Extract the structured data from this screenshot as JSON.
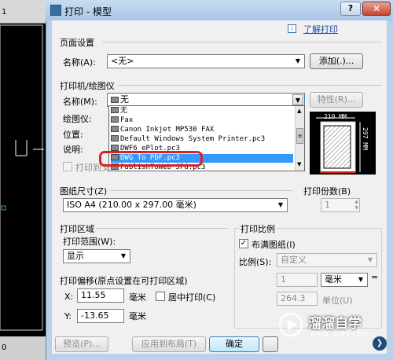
{
  "window": {
    "title": "打印 - 模型",
    "help_label": "?",
    "close_label": "✕"
  },
  "help_link": "了解打印",
  "page_setup": {
    "group_label": "页面设置",
    "name_label": "名称(A):",
    "name_value": "<无>",
    "add_button": "添加(.)..."
  },
  "printer": {
    "group_label": "打印机/绘图仪",
    "name_label": "名称(M):",
    "name_value": "无",
    "properties_button": "特性(R)...",
    "plotter_label": "绘图仪:",
    "location_label": "位置:",
    "description_label": "说明:",
    "print_to_file_label": "打印到文",
    "dropdown_items": [
      "无",
      "Fax",
      "Canon Inkjet MP530 FAX",
      "Default Windows System Printer.pc3",
      "DWF6 ePlot.pc3",
      "DWG To PDF.pc3",
      "PublishToWeb JPG.pc3"
    ],
    "selected_item": "DWG To PDF.pc3"
  },
  "preview": {
    "width_label": "210 MM",
    "height_label": "297 MM"
  },
  "paper_size": {
    "label": "图纸尺寸(Z)",
    "value": "ISO A4 (210.00 x 297.00 毫米)"
  },
  "copies": {
    "label": "打印份数(B)",
    "value": "1"
  },
  "plot_area": {
    "group_label": "打印区域",
    "range_label": "打印范围(W):",
    "range_value": "显示"
  },
  "plot_scale": {
    "group_label": "打印比例",
    "fit_label": "布满图纸(I)",
    "fit_checked": true,
    "scale_label": "比例(S):",
    "scale_value": "自定义",
    "value1": "1",
    "unit_value": "毫米",
    "equals": "=",
    "value2": "264.3",
    "unit_label": "单位(U)"
  },
  "plot_offset": {
    "group_label": "打印偏移(原点设置在可打印区域)",
    "x_label": "X:",
    "x_value": "11.55",
    "x_unit": "毫米",
    "center_label": "居中打印(C)",
    "y_label": "Y:",
    "y_value": "-13.65",
    "y_unit": "毫米"
  },
  "buttons": {
    "preview": "预览(P)...",
    "apply": "应用到布局(T)",
    "ok": "确定"
  },
  "cad": {
    "tab_text": "1",
    "status_text": "0"
  },
  "watermark": {
    "brand": "溜溜自学",
    "url": "ZIXUE.3066.COM"
  }
}
